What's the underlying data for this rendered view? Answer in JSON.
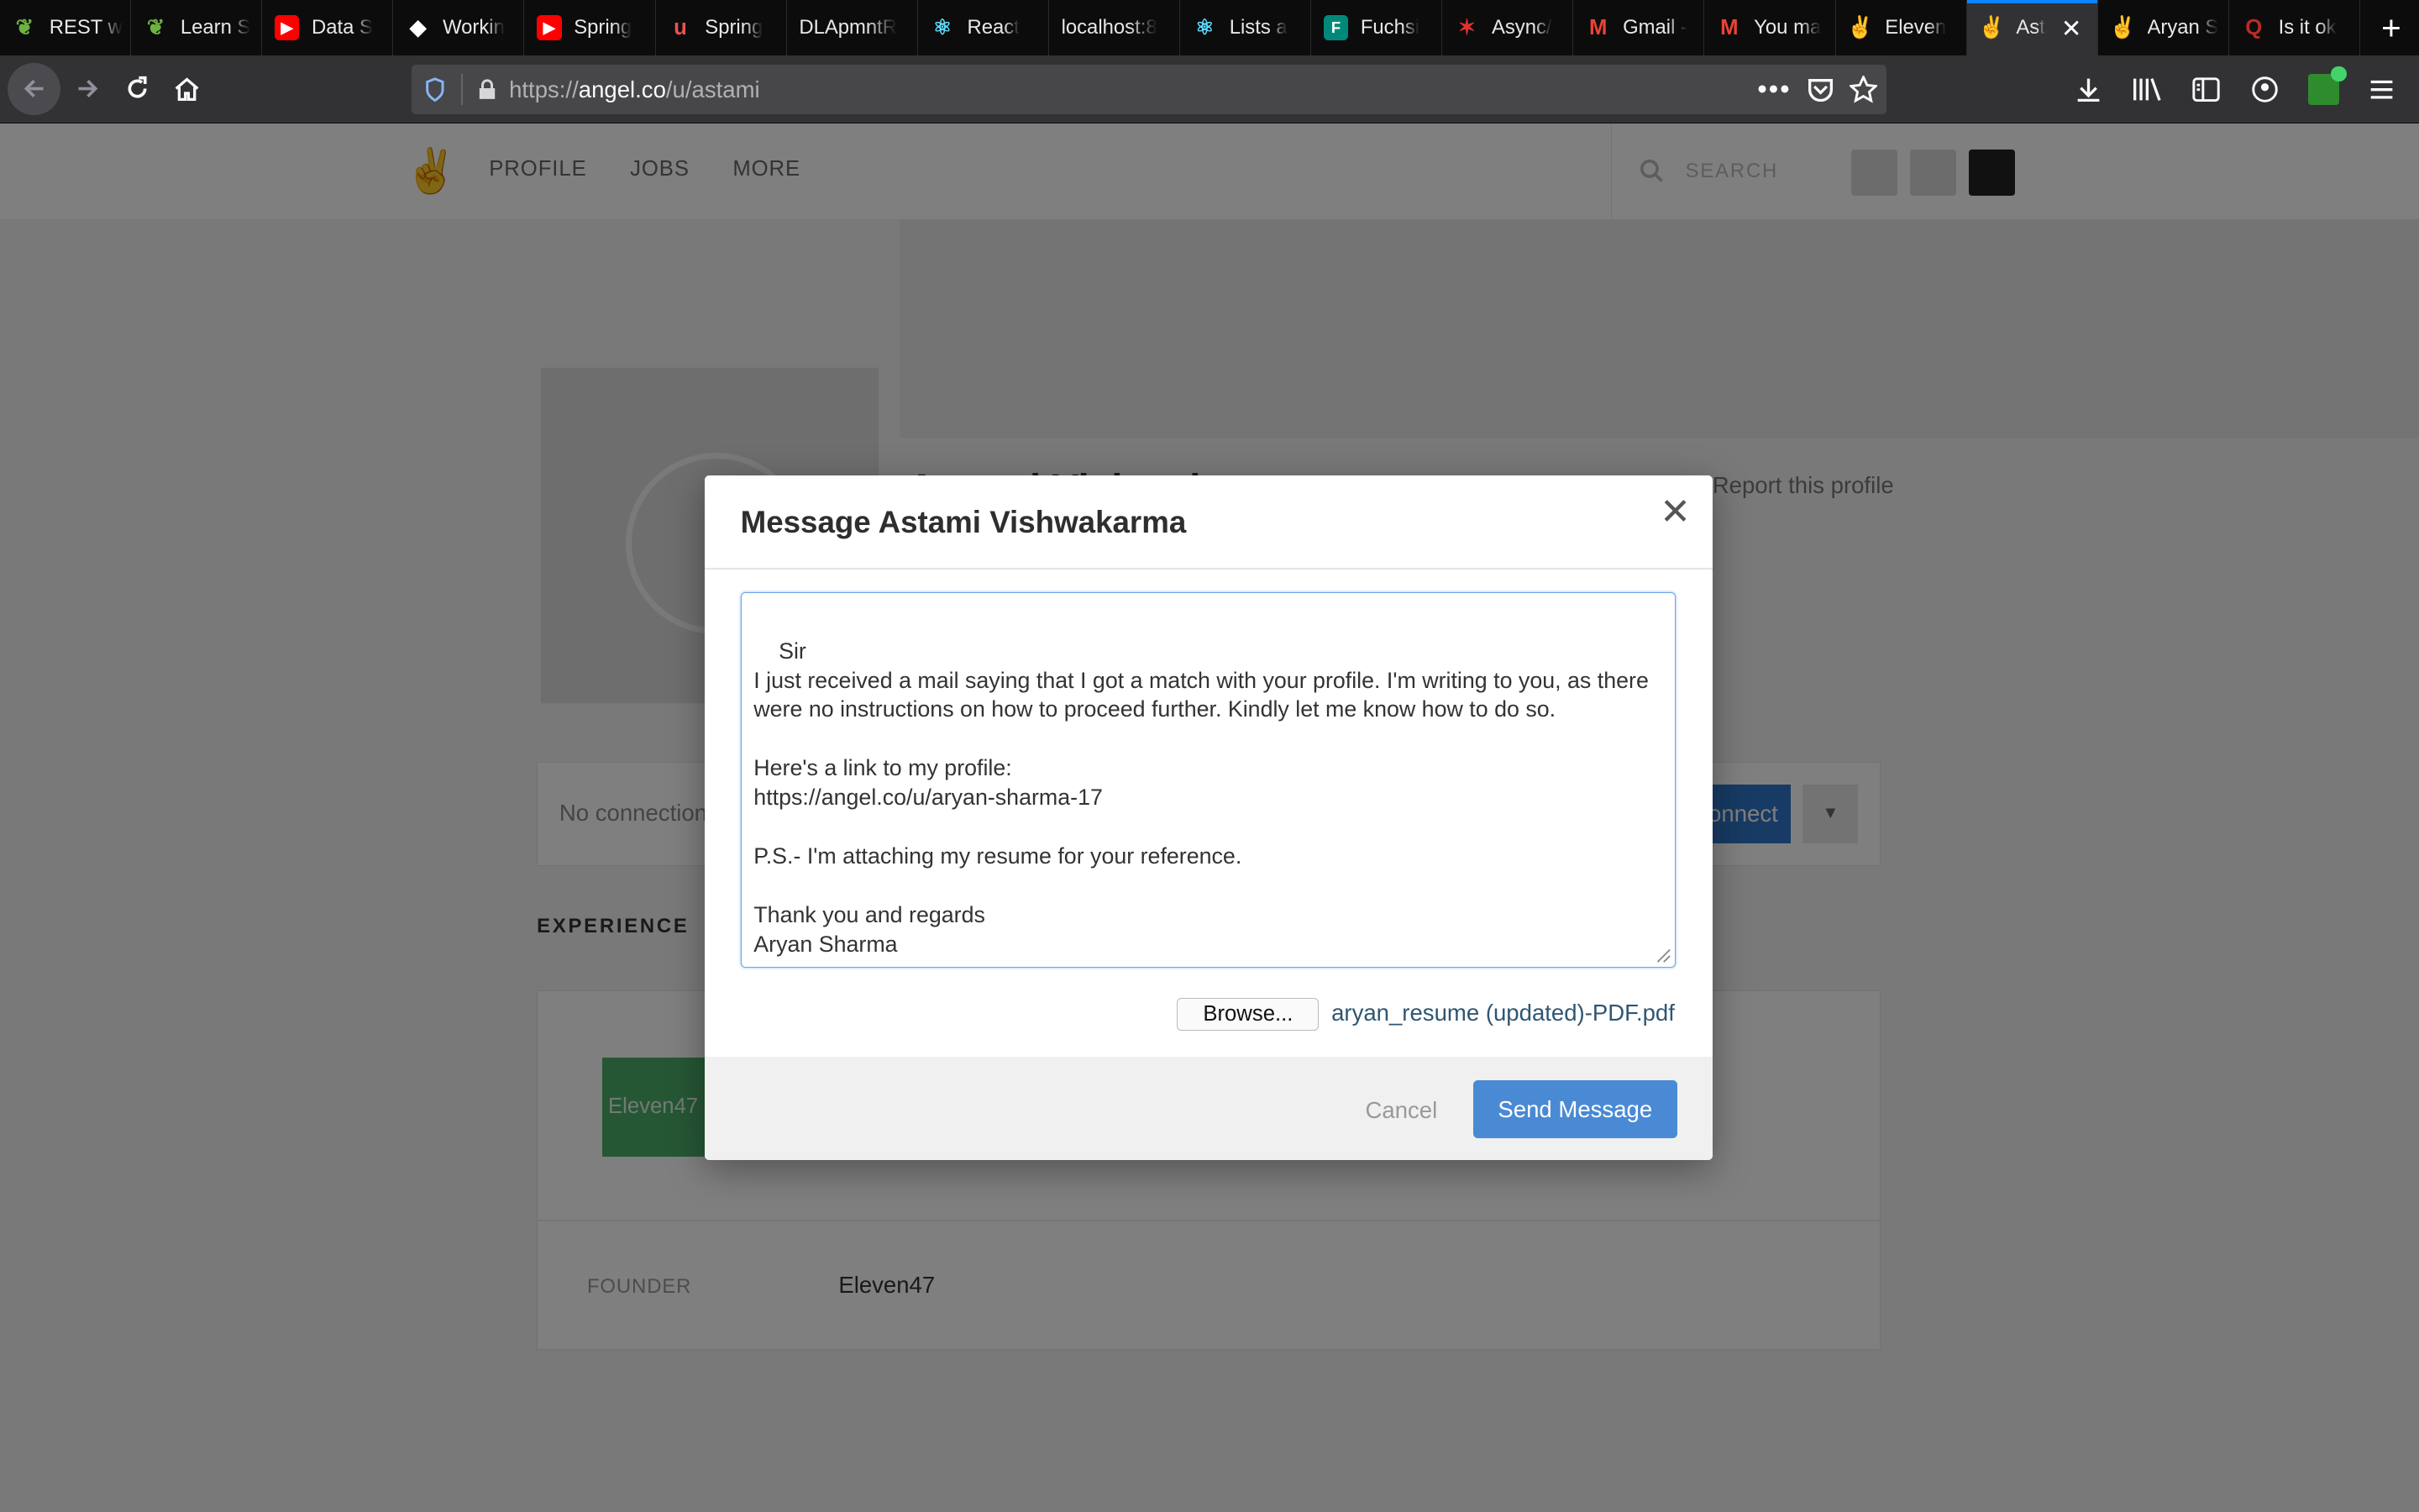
{
  "browser": {
    "tabs": [
      {
        "label": "REST w",
        "icon": "leaf-icon",
        "color": "#6db33f"
      },
      {
        "label": "Learn S",
        "icon": "leaf-icon",
        "color": "#6db33f"
      },
      {
        "label": "Data S",
        "icon": "youtube-icon",
        "color": "#ff0000"
      },
      {
        "label": "Workin",
        "icon": "code-icon",
        "color": "#ffffff"
      },
      {
        "label": "Spring",
        "icon": "youtube-icon",
        "color": "#ff0000"
      },
      {
        "label": "Spring",
        "icon": "udemy-icon",
        "color": "#ec5252"
      },
      {
        "label": "DLApmntR",
        "icon": "",
        "color": ""
      },
      {
        "label": "React",
        "icon": "react-icon",
        "color": "#61dafb"
      },
      {
        "label": "localhost:8",
        "icon": "",
        "color": ""
      },
      {
        "label": "Lists a",
        "icon": "react-icon",
        "color": "#61dafb"
      },
      {
        "label": "Fuchsi",
        "icon": "fuchsia-icon",
        "color": "#00897b"
      },
      {
        "label": "Async/",
        "icon": "figure-icon",
        "color": "#e03131"
      },
      {
        "label": "Gmail -",
        "icon": "gmail-icon",
        "color": "#ea4335"
      },
      {
        "label": "You ma",
        "icon": "gmail-icon",
        "color": "#ea4335"
      },
      {
        "label": "Eleven",
        "icon": "angellist-icon",
        "color": "#ffffff"
      },
      {
        "label": "Ast",
        "icon": "angellist-icon",
        "color": "#ffffff",
        "active": true
      },
      {
        "label": "Aryan S",
        "icon": "angellist-icon",
        "color": "#ffffff"
      },
      {
        "label": "Is it ok",
        "icon": "quora-icon",
        "color": "#b92b27"
      }
    ],
    "url_prefix": "https://",
    "url_host": "angel.co",
    "url_path": "/u/astami"
  },
  "site": {
    "nav": [
      "PROFILE",
      "JOBS",
      "MORE"
    ],
    "search_placeholder": "SEARCH",
    "name_partial": "Astami Vishwakarma",
    "report": "Report this profile",
    "no_connections": "No connections",
    "connect": "Connect",
    "experience_heading": "EXPERIENCE",
    "company_logo_text": "Eleven47",
    "role": "FOUNDER",
    "company": "Eleven47"
  },
  "modal": {
    "title": "Message Astami Vishwakarma",
    "message": "Sir\nI just received a mail saying that I got a match with your profile. I'm writing to you, as there were no instructions on how to proceed further. Kindly let me know how to do so.\n\nHere's a link to my profile:\nhttps://angel.co/u/aryan-sharma-17\n\nP.S.- I'm attaching my resume for your reference.\n\nThank you and regards\nAryan Sharma",
    "browse_label": "Browse...",
    "file_name": "aryan_resume (updated)-PDF.pdf",
    "cancel_label": "Cancel",
    "send_label": "Send Message"
  },
  "colors": {
    "accent": "#4a8ad4",
    "tab_highlight": "#0a84ff",
    "chrome_bg": "#0c0c0d"
  }
}
